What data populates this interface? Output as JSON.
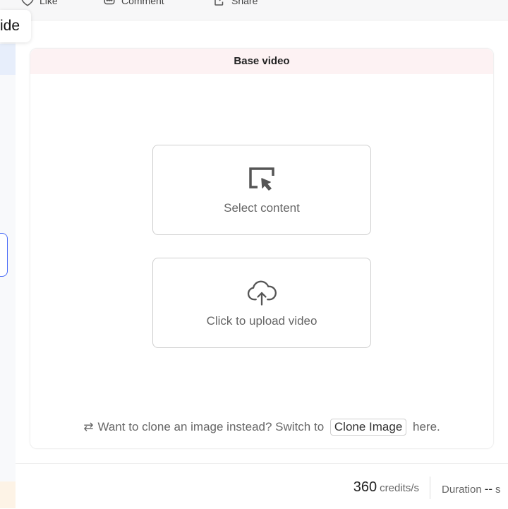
{
  "top_actions": {
    "like_label": "Like",
    "comment_label": "Comment",
    "share_label": "Share"
  },
  "guide_tab_label": "ide",
  "card": {
    "title": "Base video",
    "select_content_label": "Select content",
    "upload_label": "Click to upload video",
    "switch_text_before": "Want to clone an image instead? Switch to",
    "clone_image_button": "Clone Image",
    "switch_text_after": "here."
  },
  "footer": {
    "credits_value": "360",
    "credits_unit": "credits/s",
    "duration_label": "Duration",
    "duration_value": "--",
    "duration_unit": "s"
  },
  "icons": {
    "like": "heart-icon",
    "comment": "comment-icon",
    "share": "share-icon",
    "select": "cursor-select-icon",
    "upload": "cloud-upload-icon",
    "swap": "swap-arrows-icon"
  }
}
